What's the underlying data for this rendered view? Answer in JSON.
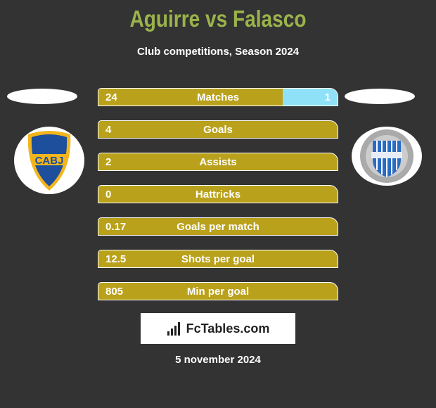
{
  "title": "Aguirre vs Falasco",
  "subtitle": "Club competitions, Season 2024",
  "left_team": {
    "logo_text": "CABJ"
  },
  "right_team": {
    "logo_text": "C.D.G.C.A.T."
  },
  "colors": {
    "left": "#b9a11b",
    "right": "#8fe1f7",
    "title": "#9bb34a"
  },
  "stats": [
    {
      "label": "Matches",
      "left": "24",
      "right": "1",
      "right_fill": 0.23
    },
    {
      "label": "Goals",
      "left": "4",
      "right": "",
      "right_fill": 0
    },
    {
      "label": "Assists",
      "left": "2",
      "right": "",
      "right_fill": 0
    },
    {
      "label": "Hattricks",
      "left": "0",
      "right": "",
      "right_fill": 0
    },
    {
      "label": "Goals per match",
      "left": "0.17",
      "right": "",
      "right_fill": 0
    },
    {
      "label": "Shots per goal",
      "left": "12.5",
      "right": "",
      "right_fill": 0
    },
    {
      "label": "Min per goal",
      "left": "805",
      "right": "",
      "right_fill": 0
    }
  ],
  "brand": "FcTables.com",
  "date": "5 november 2024"
}
